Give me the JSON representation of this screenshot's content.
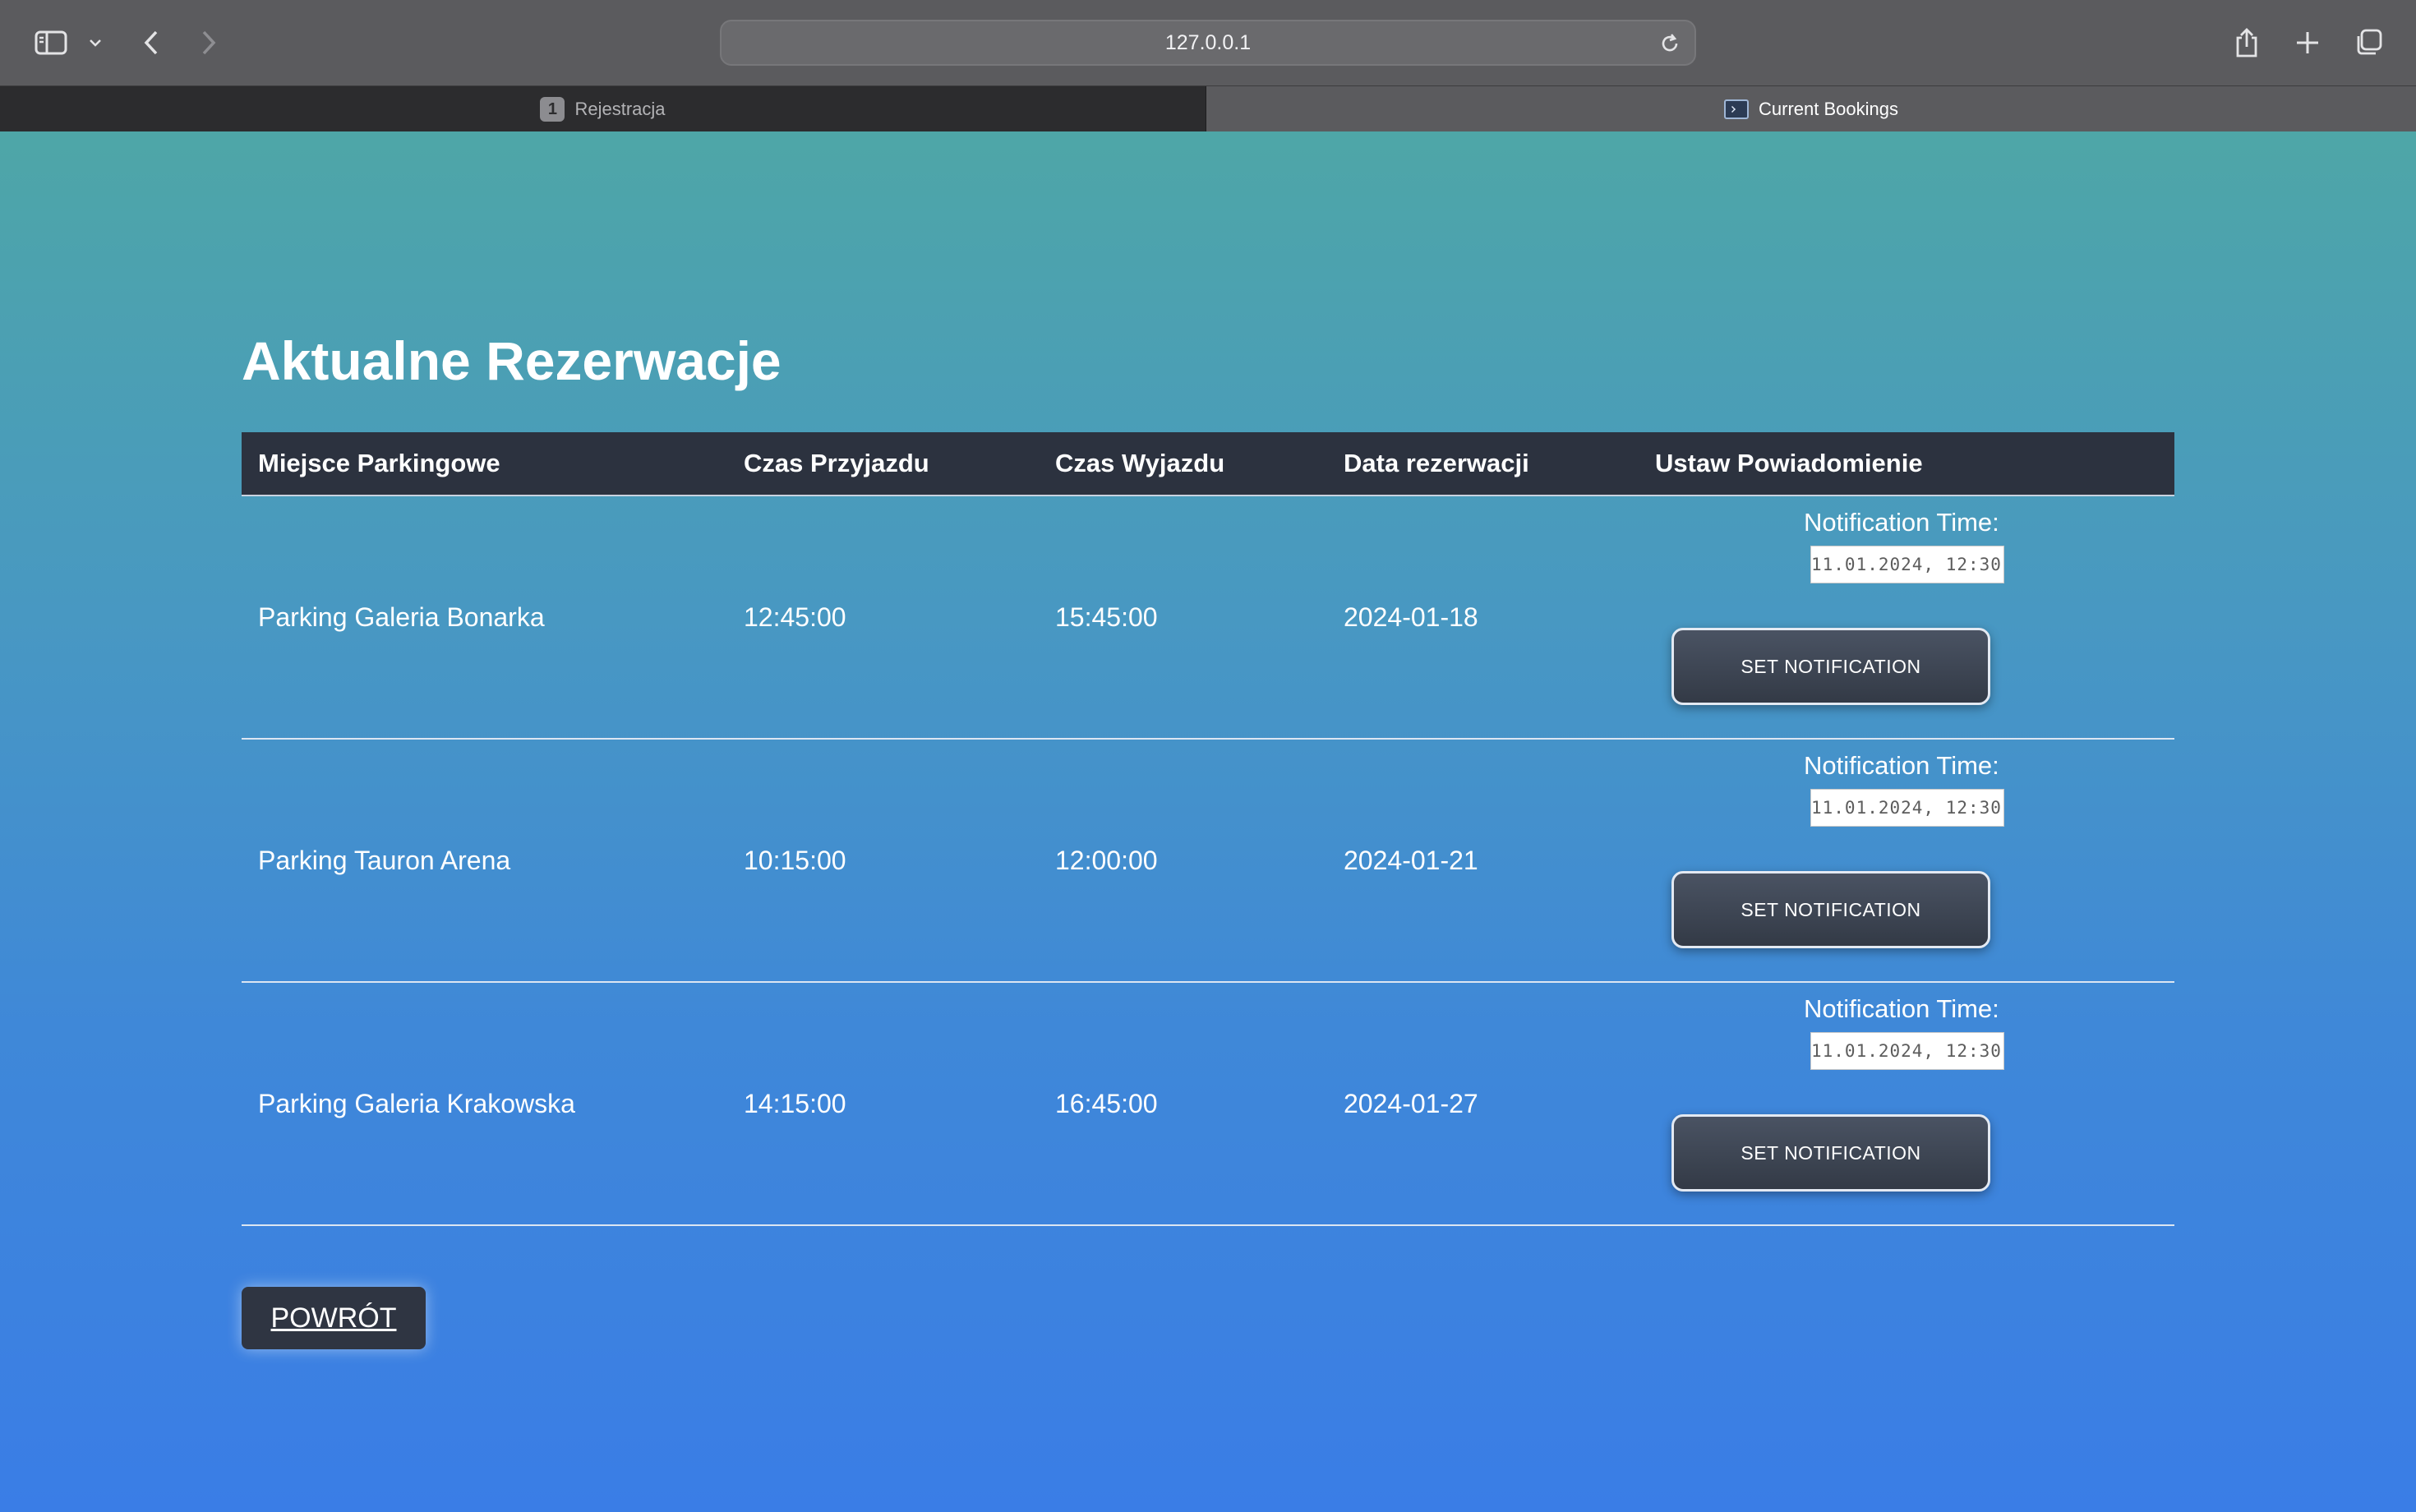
{
  "browser": {
    "url": "127.0.0.1",
    "tabs": [
      {
        "badge": "1",
        "label": "Rejestracja",
        "active": false
      },
      {
        "label": "Current Bookings",
        "active": true
      }
    ]
  },
  "page": {
    "title": "Aktualne Rezerwacje",
    "columns": [
      "Miejsce Parkingowe",
      "Czas Przyjazdu",
      "Czas Wyjazdu",
      "Data rezerwacji",
      "Ustaw Powiadomienie"
    ],
    "rows": [
      {
        "place": "Parking Galeria Bonarka",
        "arrival": "12:45:00",
        "departure": "15:45:00",
        "date": "2024-01-18",
        "notification_label": "Notification Time:",
        "notification_value": "11.01.2024, 12:30",
        "button_label": "SET NOTIFICATION"
      },
      {
        "place": "Parking Tauron Arena",
        "arrival": "10:15:00",
        "departure": "12:00:00",
        "date": "2024-01-21",
        "notification_label": "Notification Time:",
        "notification_value": "11.01.2024, 12:30",
        "button_label": "SET NOTIFICATION"
      },
      {
        "place": "Parking Galeria Krakowska",
        "arrival": "14:15:00",
        "departure": "16:45:00",
        "date": "2024-01-27",
        "notification_label": "Notification Time:",
        "notification_value": "11.01.2024, 12:30",
        "button_label": "SET NOTIFICATION"
      }
    ],
    "back_button": "POWRÓT"
  },
  "colors": {
    "gradient_top": "#4ea6a7",
    "gradient_bottom": "#3a7de6",
    "table_header": "#2c323f",
    "button": "#333a46"
  }
}
